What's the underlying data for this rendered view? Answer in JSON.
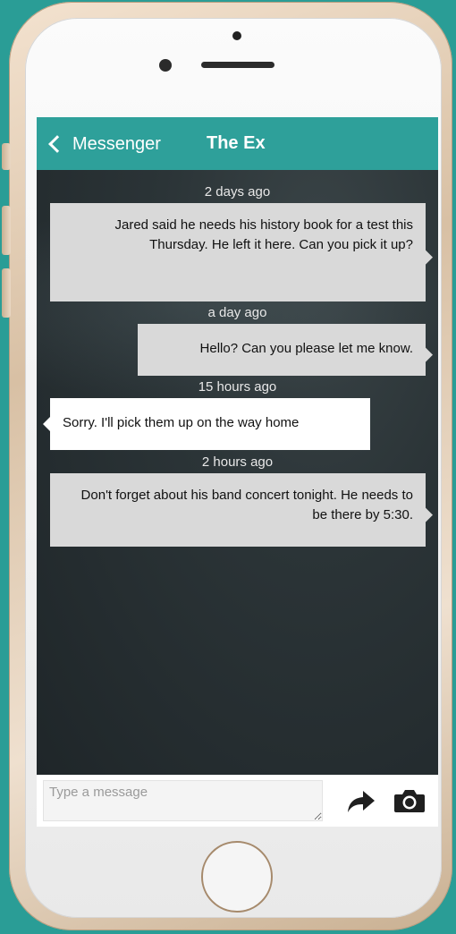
{
  "header": {
    "back_label": "Messenger",
    "title": "The Ex"
  },
  "messages": [
    {
      "timestamp": "2 days ago",
      "text": "Jared said he needs his history book for a test this Thursday. He left it here. Can you pick it up?",
      "direction": "outgoing"
    },
    {
      "timestamp": "a day ago",
      "text": "Hello? Can you please let me know.",
      "direction": "outgoing"
    },
    {
      "timestamp": "15 hours ago",
      "text": "Sorry. I'll pick them up on the way home",
      "direction": "incoming"
    },
    {
      "timestamp": "2 hours ago",
      "text": "Don't forget about his band concert tonight. He needs to be there by 5:30.",
      "direction": "outgoing"
    }
  ],
  "composer": {
    "placeholder": "Type a message",
    "value": ""
  },
  "icons": {
    "back": "chevron-left-icon",
    "send": "arrow-right-icon",
    "camera": "camera-icon"
  },
  "colors": {
    "header": "#2ea09a",
    "background": "#2a9d96",
    "outgoing_bubble": "#d9d9d9",
    "incoming_bubble": "#ffffff"
  }
}
